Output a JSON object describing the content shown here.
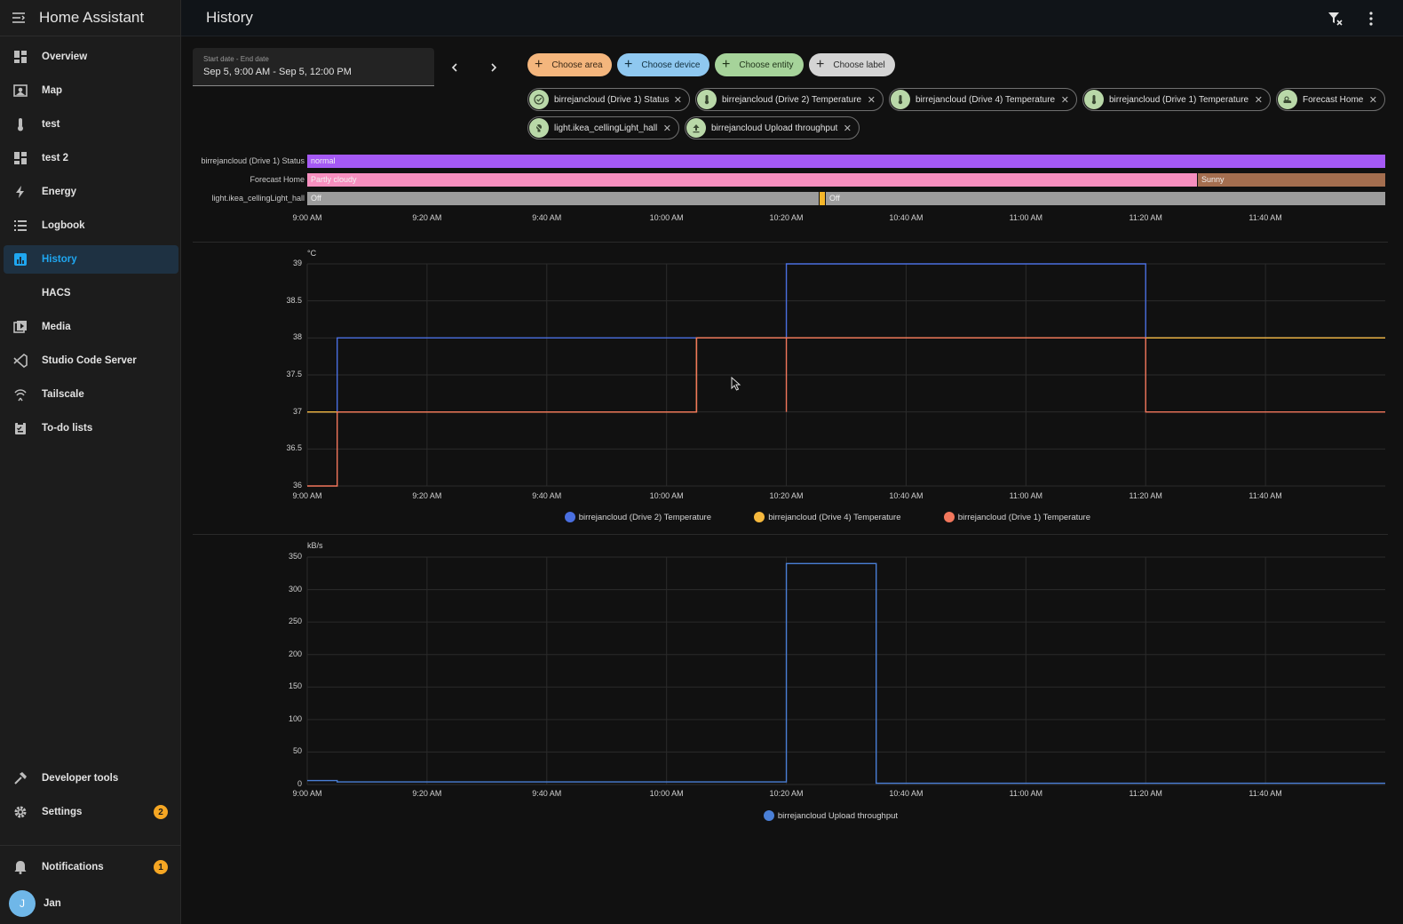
{
  "app": {
    "title": "Home Assistant"
  },
  "page": {
    "title": "History"
  },
  "sidebar": {
    "items": [
      {
        "label": "Overview"
      },
      {
        "label": "Map"
      },
      {
        "label": "test"
      },
      {
        "label": "test 2"
      },
      {
        "label": "Energy"
      },
      {
        "label": "Logbook"
      },
      {
        "label": "History"
      },
      {
        "label": "HACS"
      },
      {
        "label": "Media"
      },
      {
        "label": "Studio Code Server"
      },
      {
        "label": "Tailscale"
      },
      {
        "label": "To-do lists"
      }
    ],
    "bottom": [
      {
        "label": "Developer tools"
      },
      {
        "label": "Settings",
        "badge": "2"
      },
      {
        "label": "Notifications",
        "badge": "1"
      }
    ],
    "user": {
      "name": "Jan",
      "initial": "J"
    }
  },
  "date_picker": {
    "label": "Start date - End date",
    "value": "Sep 5, 9:00 AM - Sep 5, 12:00 PM"
  },
  "target_picker": {
    "add_chips": [
      "Choose area",
      "Choose device",
      "Choose entity",
      "Choose label"
    ],
    "selected": [
      "birrejancloud (Drive 1) Status",
      "birrejancloud (Drive 2) Temperature",
      "birrejancloud (Drive 4) Temperature",
      "birrejancloud (Drive 1) Temperature",
      "Forecast Home",
      "light.ikea_cellingLight_hall",
      "birrejancloud Upload throughput"
    ]
  },
  "colors": {
    "accent": "#1fa7f1",
    "drive2": "#4a6fe0",
    "drive4": "#f5b83d",
    "drive1": "#f2775c",
    "upload": "#4a7fd6",
    "status": "#a559f5",
    "forecast_partly": "#f78fbf",
    "forecast_sunny": "#a46e4f",
    "light_off": "#9c9c9c",
    "light_on": "#f5b62a"
  },
  "timeline": {
    "rows": [
      {
        "entity": "birrejancloud (Drive 1) Status",
        "segments": [
          {
            "state": "normal",
            "from": "9:00",
            "to": "12:00",
            "color": "#a559f5"
          }
        ]
      },
      {
        "entity": "Forecast Home",
        "segments": [
          {
            "state": "Partly cloudy",
            "from": "9:00",
            "to": "11:29",
            "color": "#f78fbf"
          },
          {
            "state": "Sunny",
            "from": "11:29",
            "to": "12:00",
            "color": "#a46e4f"
          }
        ]
      },
      {
        "entity": "light.ikea_cellingLight_hall",
        "segments": [
          {
            "state": "Off",
            "from": "9:00",
            "to": "10:24",
            "color": "#9c9c9c"
          },
          {
            "state": "",
            "from": "10:24",
            "to": "10:25",
            "color": "#f5b62a"
          },
          {
            "state": "Off",
            "from": "10:25",
            "to": "12:00",
            "color": "#9c9c9c"
          }
        ]
      }
    ],
    "ticks": [
      "9:00 AM",
      "9:20 AM",
      "9:40 AM",
      "10:00 AM",
      "10:20 AM",
      "10:40 AM",
      "11:00 AM",
      "11:20 AM",
      "11:40 AM"
    ]
  },
  "chart_data": [
    {
      "type": "line",
      "step": true,
      "ylabel": "°C",
      "ylim": [
        36,
        39
      ],
      "y_ticks": [
        "39",
        "38.5",
        "38",
        "37.5",
        "37",
        "36.5",
        "36"
      ],
      "x_ticks": [
        "9:00 AM",
        "9:20 AM",
        "9:40 AM",
        "10:00 AM",
        "10:20 AM",
        "10:40 AM",
        "11:00 AM",
        "11:20 AM",
        "11:40 AM"
      ],
      "grid": true,
      "legend": "bottom",
      "series": [
        {
          "name": "birrejancloud (Drive 2) Temperature",
          "color": "#4a6fe0",
          "points": [
            [
              "9:00",
              37
            ],
            [
              "9:05",
              38
            ],
            [
              "10:20",
              39
            ],
            [
              "11:20",
              38
            ]
          ]
        },
        {
          "name": "birrejancloud (Drive 4) Temperature",
          "color": "#f5b83d",
          "points": [
            [
              "9:00",
              37
            ],
            [
              "10:05",
              38
            ]
          ]
        },
        {
          "name": "birrejancloud (Drive 1) Temperature",
          "color": "#f2775c",
          "points": [
            [
              "9:00",
              36
            ],
            [
              "9:05",
              37
            ],
            [
              "10:05",
              38
            ],
            [
              "10:20",
              37
            ],
            [
              "10:20",
              38
            ],
            [
              "11:20",
              37
            ]
          ]
        }
      ]
    },
    {
      "type": "line",
      "step": true,
      "ylabel": "kB/s",
      "ylim": [
        0,
        350
      ],
      "y_ticks": [
        "350",
        "300",
        "250",
        "200",
        "150",
        "100",
        "50",
        "0"
      ],
      "x_ticks": [
        "9:00 AM",
        "9:20 AM",
        "9:40 AM",
        "10:00 AM",
        "10:20 AM",
        "10:40 AM",
        "11:00 AM",
        "11:20 AM",
        "11:40 AM"
      ],
      "grid": true,
      "legend": "bottom",
      "series": [
        {
          "name": "birrejancloud Upload throughput",
          "color": "#4a7fd6",
          "points": [
            [
              "9:00",
              6
            ],
            [
              "9:05",
              4
            ],
            [
              "10:20",
              340
            ],
            [
              "10:35",
              2
            ]
          ]
        }
      ]
    }
  ]
}
